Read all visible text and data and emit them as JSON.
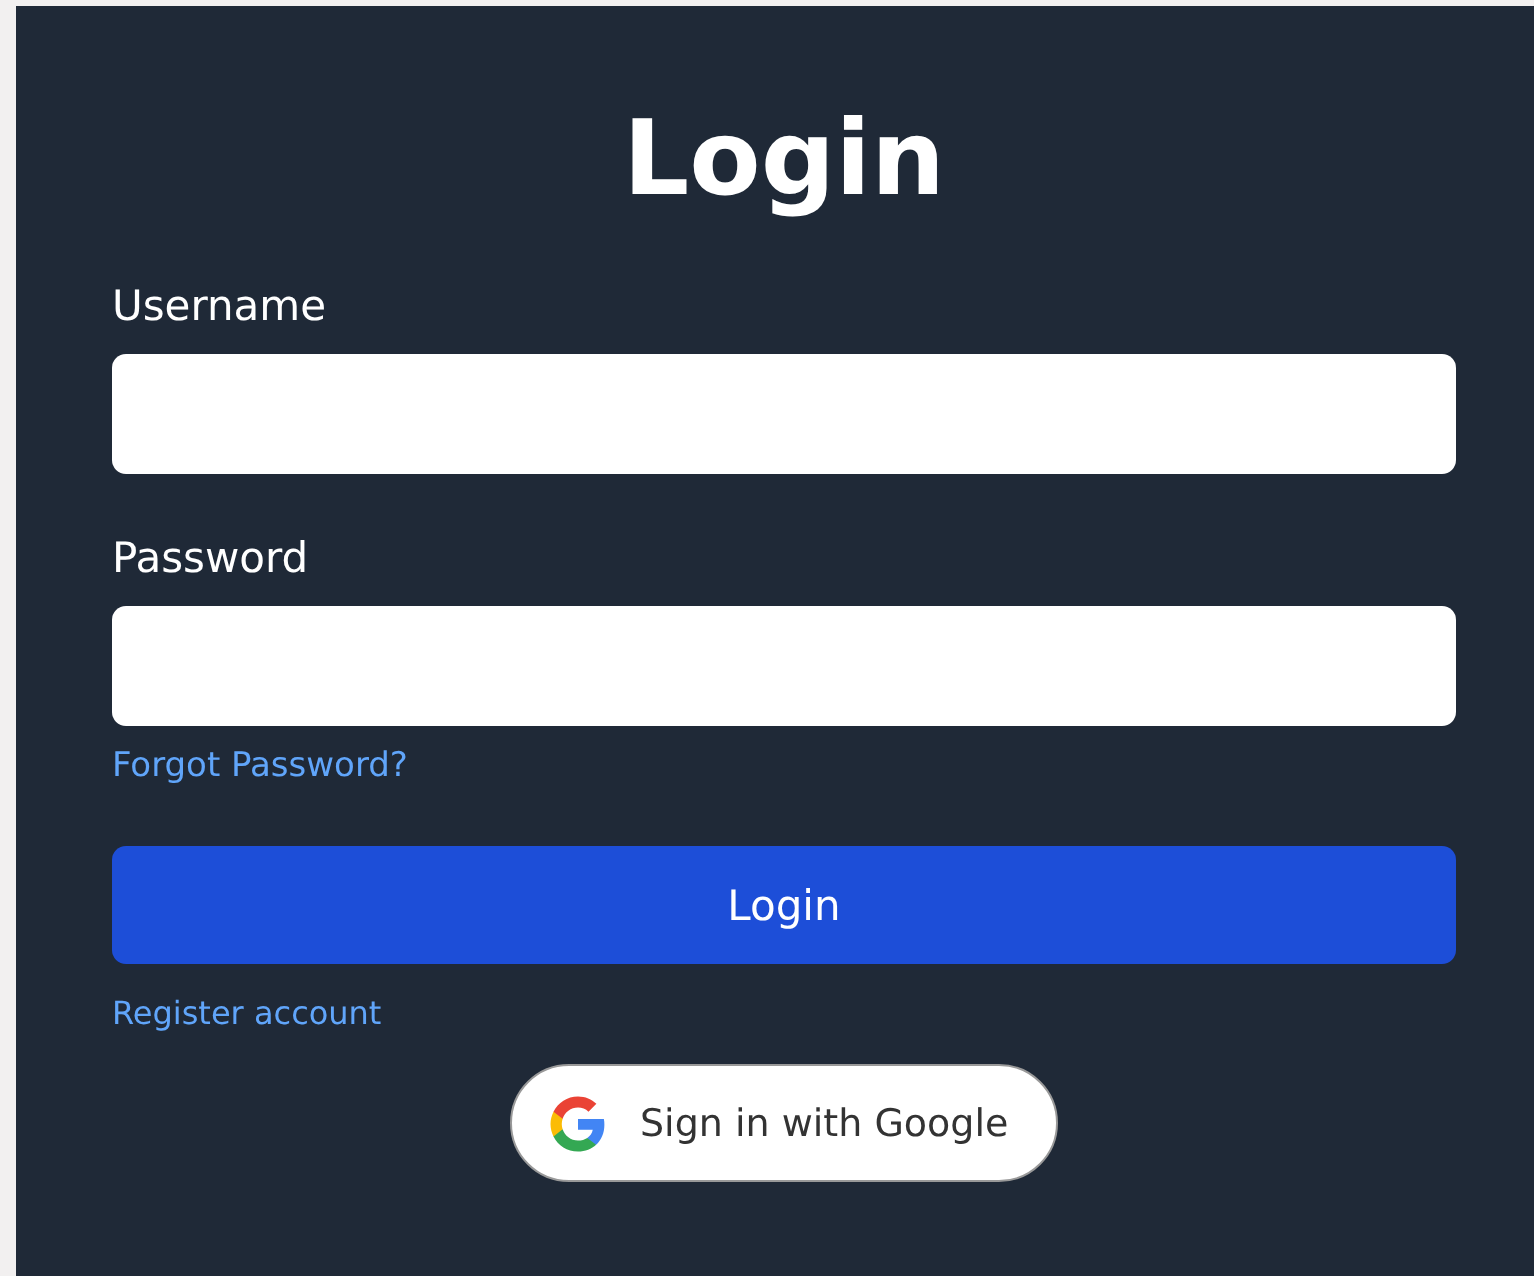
{
  "title": "Login",
  "fields": [
    {
      "label": "Username"
    },
    {
      "label": "Password"
    }
  ],
  "forgot_link": "Forgot Password?",
  "submit_button": "Login",
  "register_link": "Register account",
  "google_button": "Sign in with Google"
}
